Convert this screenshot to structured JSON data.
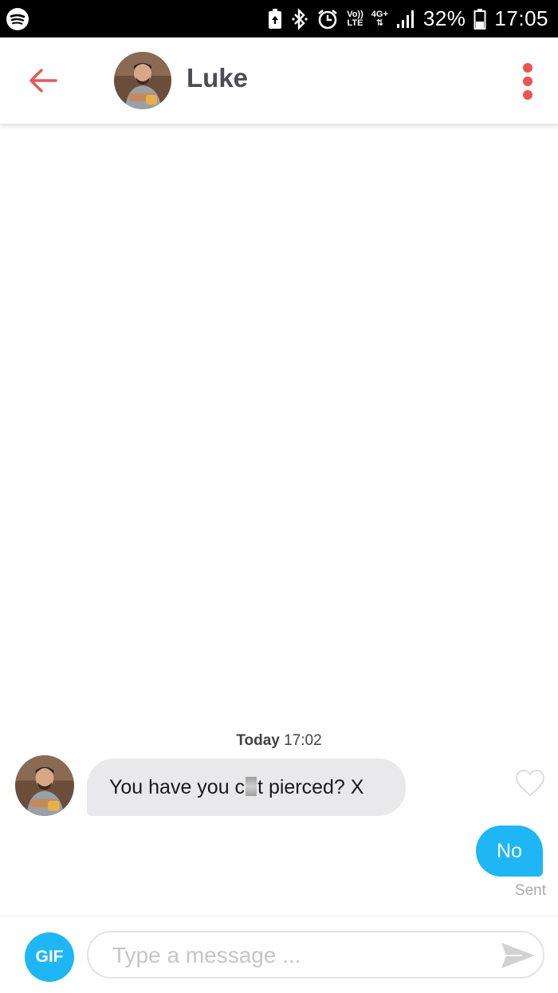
{
  "status_bar": {
    "network_top": "Vo))",
    "network_bottom": "LTE",
    "data_type": "4G+",
    "battery_percent": "32%",
    "time": "17:05",
    "icons": [
      "spotify-icon",
      "battery-saver-icon",
      "bluetooth-icon",
      "alarm-icon",
      "signal-icon",
      "battery-icon"
    ]
  },
  "header": {
    "contact_name": "Luke",
    "back_icon": "back-arrow-icon",
    "menu_icon": "more-vertical-icon"
  },
  "chat": {
    "timestamp_day": "Today",
    "timestamp_time": "17:02",
    "incoming_message_before": "You have you c",
    "incoming_message_after": "t pierced? X",
    "outgoing_message": "No",
    "outgoing_status": "Sent"
  },
  "composer": {
    "gif_label": "GIF",
    "placeholder": "Type a message ...",
    "value": ""
  },
  "colors": {
    "accent_red": "#ef5350",
    "accent_blue": "#1eb6f5",
    "bubble_grey": "#e9e9eb",
    "title_text": "#4a4d52"
  }
}
